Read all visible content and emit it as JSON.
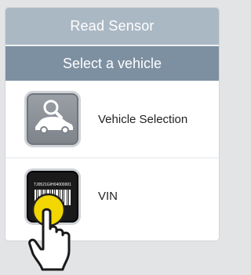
{
  "header": {
    "title": "Read Sensor",
    "subtitle": "Select a vehicle"
  },
  "items": [
    {
      "label": "Vehicle Selection",
      "icon": "vehicle-search-icon"
    },
    {
      "label": "VIN",
      "icon": "vin-barcode-icon",
      "barcode_text": "TJ0521GIH04000001"
    }
  ],
  "colors": {
    "header_top": "#aab8c4",
    "header_bottom": "#7d90a2",
    "background": "#e3e4e6",
    "tap_highlight": "#f2d600"
  },
  "overlay": {
    "icon": "tap-hand-icon"
  }
}
